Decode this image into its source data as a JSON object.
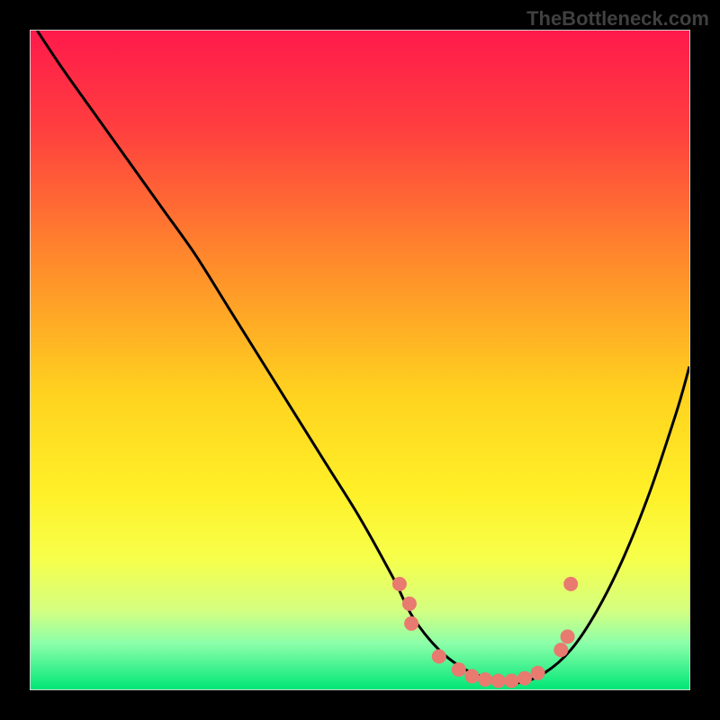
{
  "watermark": "TheBottleneck.com",
  "chart_data": {
    "type": "line",
    "title": "",
    "xlabel": "",
    "ylabel": "",
    "xlim": [
      0,
      100
    ],
    "ylim": [
      0,
      100
    ],
    "grid": false,
    "legend": false,
    "gradient_stops": [
      {
        "pos": 0.0,
        "color": "#ff1a4b"
      },
      {
        "pos": 0.15,
        "color": "#ff3f3f"
      },
      {
        "pos": 0.35,
        "color": "#ff8a2b"
      },
      {
        "pos": 0.55,
        "color": "#ffd21f"
      },
      {
        "pos": 0.7,
        "color": "#fff028"
      },
      {
        "pos": 0.8,
        "color": "#f7ff4a"
      },
      {
        "pos": 0.88,
        "color": "#d4ff80"
      },
      {
        "pos": 0.93,
        "color": "#8cffaa"
      },
      {
        "pos": 1.0,
        "color": "#00e676"
      }
    ],
    "series": [
      {
        "name": "bottleneck-curve",
        "color": "#000000",
        "x": [
          1,
          5,
          10,
          15,
          20,
          25,
          30,
          35,
          40,
          45,
          50,
          55,
          58,
          62,
          66,
          70,
          74,
          78,
          82,
          86,
          90,
          94,
          98,
          100
        ],
        "y": [
          100,
          94,
          87,
          80,
          73,
          66,
          58,
          50,
          42,
          34,
          26,
          17,
          11,
          6,
          3,
          1.5,
          1,
          2.5,
          6,
          12,
          20,
          30,
          42,
          49
        ]
      }
    ],
    "points": {
      "name": "highlighted-points",
      "color": "#e87a6f",
      "radius": 8,
      "x": [
        56,
        57.5,
        57.8,
        62,
        65,
        67,
        69,
        71,
        73,
        75,
        77,
        80.5,
        81.5,
        82
      ],
      "y": [
        16,
        13,
        10,
        5,
        3,
        2,
        1.5,
        1.3,
        1.3,
        1.7,
        2.5,
        6,
        8,
        16
      ]
    }
  }
}
